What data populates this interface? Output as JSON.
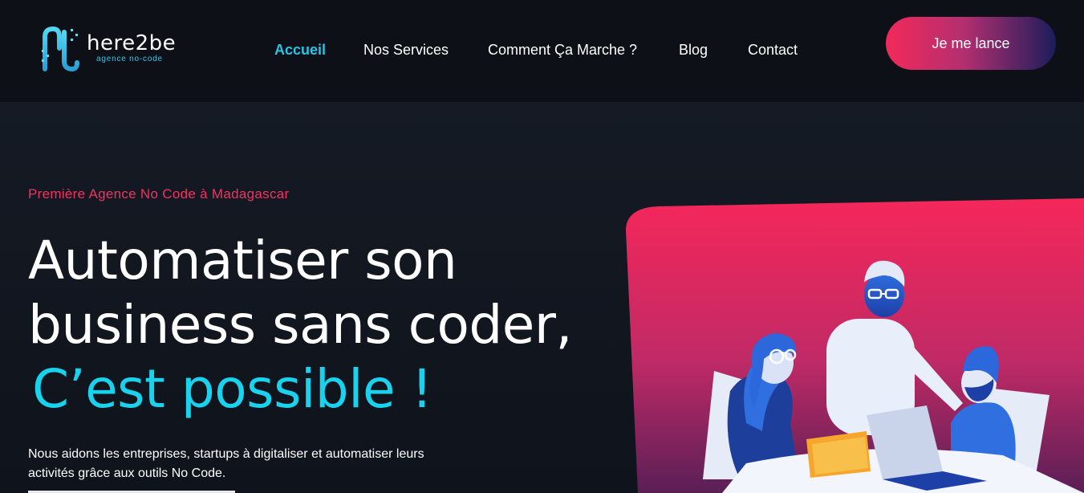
{
  "brand": {
    "name": "here2be",
    "tagline": "agence no-code",
    "logo_icon": "here2be-logo-icon"
  },
  "nav": {
    "items": [
      {
        "label": "Accueil",
        "active": true
      },
      {
        "label": "Nos Services",
        "active": false
      },
      {
        "label": "Comment Ça Marche ?",
        "active": false
      },
      {
        "label": "Blog",
        "active": false
      },
      {
        "label": "Contact",
        "active": false
      }
    ],
    "cta_label": "Je me lance"
  },
  "hero": {
    "eyebrow": "Première Agence No Code à Madagascar",
    "headline_line1": "Automatiser son",
    "headline_line2": "business sans coder,",
    "headline_accent": "C’est possible !",
    "lead": "Nous aidons les entreprises, startups à digitaliser et automatiser leurs activités grâce aux outils No Code.",
    "illustration": "team-collaboration-illustration"
  },
  "colors": {
    "background": "#0e121a",
    "accent_cyan": "#19d3ee",
    "accent_pink": "#f0345f",
    "cta_gradient_start": "#f2295a",
    "cta_gradient_end": "#1b1d5c"
  }
}
